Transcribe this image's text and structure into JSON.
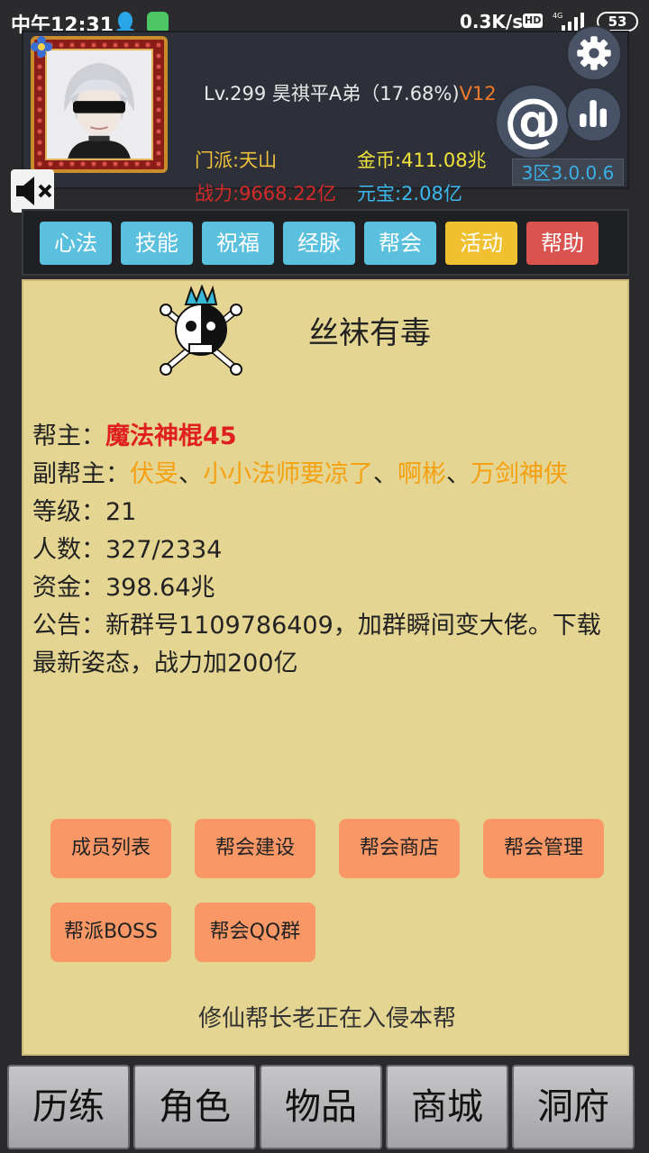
{
  "status_bar": {
    "time": "中午12:31",
    "net_speed": "0.3K/s",
    "hd_label": "HD",
    "network": "4G",
    "battery": "53"
  },
  "player": {
    "level_name": "Lv.299 昊祺平A弟（17.68%)",
    "vip": "V12",
    "sect": "门派:天山",
    "power": "战力:9668.22亿",
    "gold": "金币:411.08兆",
    "yuanbao": "元宝:2.08亿",
    "server_version": "3区3.0.0.6"
  },
  "icons": {
    "settings": "gear-icon",
    "mention": "at-icon",
    "stats": "bar-chart-icon",
    "mute": "speaker-mute-icon"
  },
  "tabs": [
    {
      "label": "心法",
      "color": "#5bc0de"
    },
    {
      "label": "技能",
      "color": "#5bc0de"
    },
    {
      "label": "祝福",
      "color": "#5bc0de"
    },
    {
      "label": "经脉",
      "color": "#5bc0de"
    },
    {
      "label": "帮会",
      "color": "#5bc0de"
    },
    {
      "label": "活动",
      "color": "#f0c030"
    },
    {
      "label": "帮助",
      "color": "#d9534f"
    }
  ],
  "guild": {
    "name": "丝袜有毒",
    "leader_label": "帮主：",
    "leader": "魔法神棍45",
    "deputy_label": "副帮主：",
    "deputies": [
      "伏旻",
      "小小法师要凉了",
      "啊彬",
      "万剑神侠"
    ],
    "separator": "、",
    "level_label": "等级：",
    "level": "21",
    "members_label": "人数：",
    "members": "327/2334",
    "funds_label": "资金：",
    "funds": "398.64兆",
    "notice_label": "公告：",
    "notice": "新群号1109786409，加群瞬间变大佬。下载最新姿态，战力加200亿",
    "invade_message": "修仙帮长老正在入侵本帮"
  },
  "guild_actions": [
    "成员列表",
    "帮会建设",
    "帮会商店",
    "帮会管理",
    "帮派BOSS",
    "帮会QQ群"
  ],
  "bottom_nav": [
    "历练",
    "角色",
    "物品",
    "商城",
    "洞府"
  ]
}
